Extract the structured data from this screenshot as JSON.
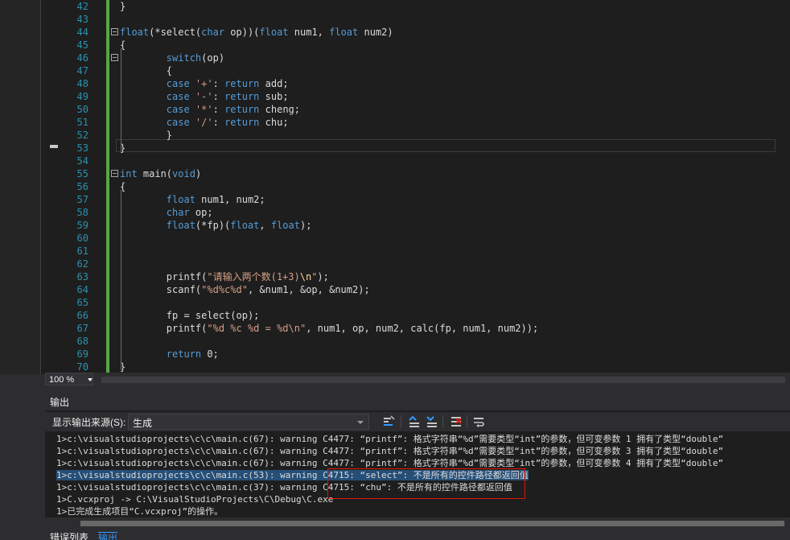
{
  "editor": {
    "lines": [
      {
        "n": "42",
        "fold": false,
        "parts": [
          {
            "t": "}",
            "c": ""
          }
        ]
      },
      {
        "n": "43",
        "fold": false,
        "parts": []
      },
      {
        "n": "44",
        "fold": true,
        "parts": [
          {
            "t": "float",
            "c": "kw"
          },
          {
            "t": "(*select(",
            "c": ""
          },
          {
            "t": "char",
            "c": "kw"
          },
          {
            "t": " op))(",
            "c": ""
          },
          {
            "t": "float",
            "c": "kw"
          },
          {
            "t": " num1, ",
            "c": ""
          },
          {
            "t": "float",
            "c": "kw"
          },
          {
            "t": " num2)",
            "c": ""
          }
        ]
      },
      {
        "n": "45",
        "fold": false,
        "parts": [
          {
            "t": "{",
            "c": ""
          }
        ]
      },
      {
        "n": "46",
        "fold": true,
        "parts": [
          {
            "t": "        switch",
            "c": "kw"
          },
          {
            "t": "(op)",
            "c": ""
          }
        ]
      },
      {
        "n": "47",
        "fold": false,
        "parts": [
          {
            "t": "        {",
            "c": ""
          }
        ]
      },
      {
        "n": "48",
        "fold": false,
        "parts": [
          {
            "t": "        case ",
            "c": "kw"
          },
          {
            "t": "'+'",
            "c": "str"
          },
          {
            "t": ": ",
            "c": ""
          },
          {
            "t": "return",
            "c": "kw"
          },
          {
            "t": " add;",
            "c": ""
          }
        ]
      },
      {
        "n": "49",
        "fold": false,
        "parts": [
          {
            "t": "        case ",
            "c": "kw"
          },
          {
            "t": "'-'",
            "c": "str"
          },
          {
            "t": ": ",
            "c": ""
          },
          {
            "t": "return",
            "c": "kw"
          },
          {
            "t": " sub;",
            "c": ""
          }
        ]
      },
      {
        "n": "50",
        "fold": false,
        "parts": [
          {
            "t": "        case ",
            "c": "kw"
          },
          {
            "t": "'*'",
            "c": "str"
          },
          {
            "t": ": ",
            "c": ""
          },
          {
            "t": "return",
            "c": "kw"
          },
          {
            "t": " cheng;",
            "c": ""
          }
        ]
      },
      {
        "n": "51",
        "fold": false,
        "parts": [
          {
            "t": "        case ",
            "c": "kw"
          },
          {
            "t": "'/'",
            "c": "str"
          },
          {
            "t": ": ",
            "c": ""
          },
          {
            "t": "return",
            "c": "kw"
          },
          {
            "t": " chu;",
            "c": ""
          }
        ]
      },
      {
        "n": "52",
        "fold": false,
        "parts": [
          {
            "t": "        }",
            "c": ""
          }
        ]
      },
      {
        "n": "53",
        "fold": false,
        "parts": [
          {
            "t": "}",
            "c": ""
          }
        ]
      },
      {
        "n": "54",
        "fold": false,
        "parts": []
      },
      {
        "n": "55",
        "fold": true,
        "parts": [
          {
            "t": "int",
            "c": "kw"
          },
          {
            "t": " main(",
            "c": ""
          },
          {
            "t": "void",
            "c": "kw"
          },
          {
            "t": ")",
            "c": ""
          }
        ]
      },
      {
        "n": "56",
        "fold": false,
        "parts": [
          {
            "t": "{",
            "c": ""
          }
        ]
      },
      {
        "n": "57",
        "fold": false,
        "parts": [
          {
            "t": "        float",
            "c": "kw"
          },
          {
            "t": " num1, num2;",
            "c": ""
          }
        ]
      },
      {
        "n": "58",
        "fold": false,
        "parts": [
          {
            "t": "        char",
            "c": "kw"
          },
          {
            "t": " op;",
            "c": ""
          }
        ]
      },
      {
        "n": "59",
        "fold": false,
        "parts": [
          {
            "t": "        float",
            "c": "kw"
          },
          {
            "t": "(*fp)(",
            "c": ""
          },
          {
            "t": "float",
            "c": "kw"
          },
          {
            "t": ", ",
            "c": ""
          },
          {
            "t": "float",
            "c": "kw"
          },
          {
            "t": ");",
            "c": ""
          }
        ]
      },
      {
        "n": "60",
        "fold": false,
        "parts": []
      },
      {
        "n": "61",
        "fold": false,
        "parts": []
      },
      {
        "n": "62",
        "fold": false,
        "parts": []
      },
      {
        "n": "63",
        "fold": false,
        "parts": [
          {
            "t": "        printf(",
            "c": ""
          },
          {
            "t": "\"请输入两个数(1+3)",
            "c": "str"
          },
          {
            "t": "\\n",
            "c": "esc"
          },
          {
            "t": "\"",
            "c": "str"
          },
          {
            "t": ");",
            "c": ""
          }
        ]
      },
      {
        "n": "64",
        "fold": false,
        "parts": [
          {
            "t": "        scanf(",
            "c": ""
          },
          {
            "t": "\"%d%c%d\"",
            "c": "str"
          },
          {
            "t": ", &num1, &op, &num2);",
            "c": ""
          }
        ]
      },
      {
        "n": "65",
        "fold": false,
        "parts": []
      },
      {
        "n": "66",
        "fold": false,
        "parts": [
          {
            "t": "        fp = select(op);",
            "c": ""
          }
        ]
      },
      {
        "n": "67",
        "fold": false,
        "parts": [
          {
            "t": "        printf(",
            "c": ""
          },
          {
            "t": "\"%d %c %d = %d\\n\"",
            "c": "str"
          },
          {
            "t": ", num1, op, num2, calc(fp, num1, num2));",
            "c": ""
          }
        ]
      },
      {
        "n": "68",
        "fold": false,
        "parts": []
      },
      {
        "n": "69",
        "fold": false,
        "parts": [
          {
            "t": "        return",
            "c": "kw"
          },
          {
            "t": " 0;",
            "c": ""
          }
        ]
      },
      {
        "n": "70",
        "fold": false,
        "parts": [
          {
            "t": "}",
            "c": ""
          }
        ]
      }
    ]
  },
  "zoom": {
    "value": "100 %"
  },
  "output": {
    "title": "输出",
    "source_label": "显示输出来源(S):",
    "source_value": "生成",
    "lines": [
      {
        "text": "1>c:\\visualstudioprojects\\c\\c\\main.c(67): warning C4477: “printf”: 格式字符串“%d”需要类型“int”的参数，但可变参数 1 拥有了类型“double”",
        "highlight": false
      },
      {
        "text": "1>c:\\visualstudioprojects\\c\\c\\main.c(67): warning C4477: “printf”: 格式字符串“%d”需要类型“int”的参数，但可变参数 3 拥有了类型“double”",
        "highlight": false
      },
      {
        "text": "1>c:\\visualstudioprojects\\c\\c\\main.c(67): warning C4477: “printf”: 格式字符串“%d”需要类型“int”的参数，但可变参数 4 拥有了类型“double”",
        "highlight": false
      },
      {
        "text": "1>c:\\visualstudioprojects\\c\\c\\main.c(53): warning C4715: “select”: 不是所有的控件路径都返回值",
        "highlight": true
      },
      {
        "text": "1>c:\\visualstudioprojects\\c\\c\\main.c(37): warning C4715: “chu”: 不是所有的控件路径都返回值",
        "highlight": false
      },
      {
        "text": "1>C.vcxproj -> C:\\VisualStudioProjects\\C\\Debug\\C.exe",
        "highlight": false
      },
      {
        "text": "1>已完成生成项目“C.vcxproj”的操作。",
        "highlight": false
      }
    ]
  },
  "bottom_tabs": [
    {
      "label": "错误列表",
      "active": false
    },
    {
      "label": "输出",
      "active": true
    }
  ],
  "colors": {
    "keyword": "#569cd6",
    "string": "#d69d85",
    "line_number": "#2b91af",
    "highlight": "#264f78",
    "annotation_box": "#e51400"
  }
}
